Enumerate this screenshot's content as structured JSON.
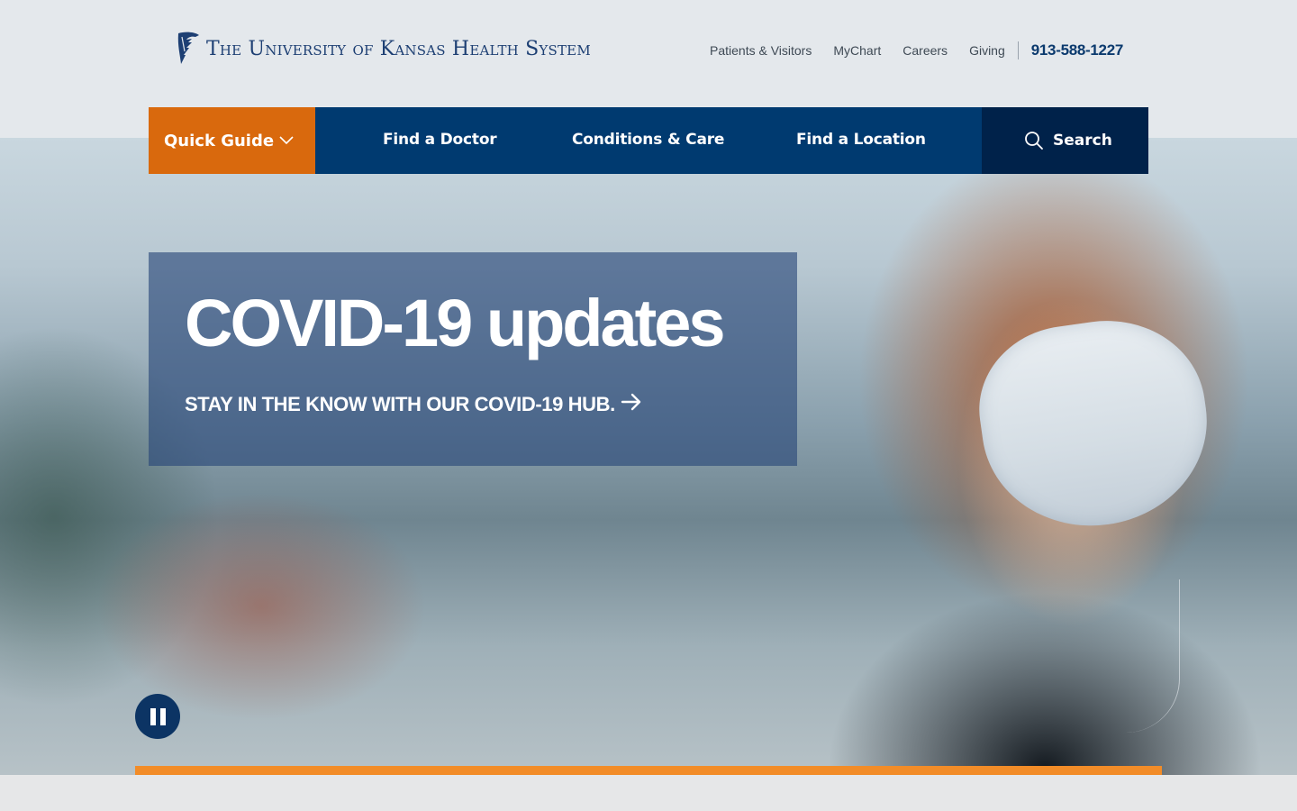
{
  "brand": {
    "name": "The University of Kansas Health System",
    "color": "#1d3f73"
  },
  "utility_nav": {
    "links": [
      "Patients & Visitors",
      "MyChart",
      "Careers",
      "Giving"
    ],
    "phone": "913-588-1227"
  },
  "main_nav": {
    "quick_guide": "Quick Guide",
    "links": [
      "Find a Doctor",
      "Conditions & Care",
      "Find a Location"
    ],
    "search": "Search",
    "colors": {
      "quick_guide": "#d9690d",
      "nav": "#003a70",
      "search": "#00224a"
    }
  },
  "hero": {
    "title": "COVID-19 updates",
    "cta": "STAY IN THE KNOW WITH OUR COVID-19 HUB.",
    "cta_icon": "arrow-right-icon",
    "pause_icon": "pause-icon"
  },
  "accent_color": "#f28c28"
}
